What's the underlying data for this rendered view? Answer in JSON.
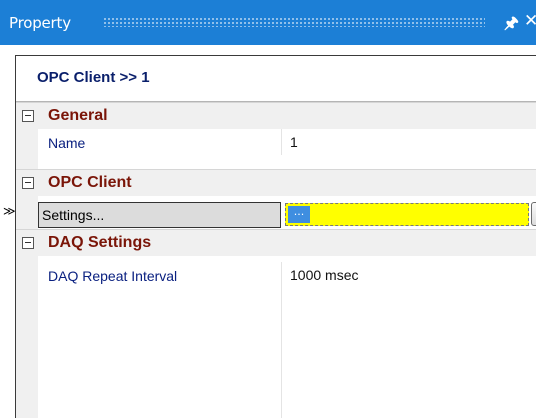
{
  "window": {
    "title": "Property",
    "pin_glyph": "2",
    "pin_icon": "pin-icon",
    "close_glyph": "✕",
    "close_icon": "close-icon"
  },
  "header": {
    "title": "OPC Client >> 1"
  },
  "categories": [
    {
      "label": "General",
      "rows": [
        {
          "name": "Name",
          "value": "1"
        }
      ]
    },
    {
      "label": "OPC Client",
      "rows": [
        {
          "name": "Settings...",
          "value": "...",
          "button": "...",
          "selected": true
        }
      ]
    },
    {
      "label": "DAQ Settings",
      "rows": [
        {
          "name": "DAQ Repeat Interval",
          "value": "1000 msec"
        }
      ]
    }
  ],
  "colors": {
    "titlebar": "#1c7fd6",
    "category_text": "#7a1508",
    "name_text": "#0a2080",
    "highlight_value": "#ffff00"
  },
  "current_row_indicator": "≫"
}
